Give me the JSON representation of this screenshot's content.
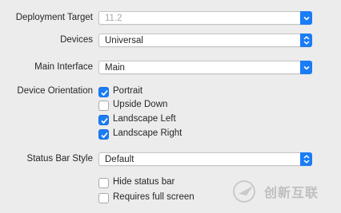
{
  "fields": {
    "deployment_target": {
      "label": "Deployment Target",
      "value": "11.2"
    },
    "devices": {
      "label": "Devices",
      "value": "Universal"
    },
    "main_interface": {
      "label": "Main Interface",
      "value": "Main"
    },
    "device_orientation": {
      "label": "Device Orientation",
      "options": [
        {
          "label": "Portrait",
          "checked": true
        },
        {
          "label": "Upside Down",
          "checked": false
        },
        {
          "label": "Landscape Left",
          "checked": true
        },
        {
          "label": "Landscape Right",
          "checked": true
        }
      ]
    },
    "status_bar_style": {
      "label": "Status Bar Style",
      "value": "Default"
    },
    "status_options": [
      {
        "label": "Hide status bar",
        "checked": false
      },
      {
        "label": "Requires full screen",
        "checked": false
      }
    ]
  },
  "watermark": {
    "text": "创新互联"
  },
  "colors": {
    "accent": "#1a7cf6",
    "background": "#ececec"
  }
}
